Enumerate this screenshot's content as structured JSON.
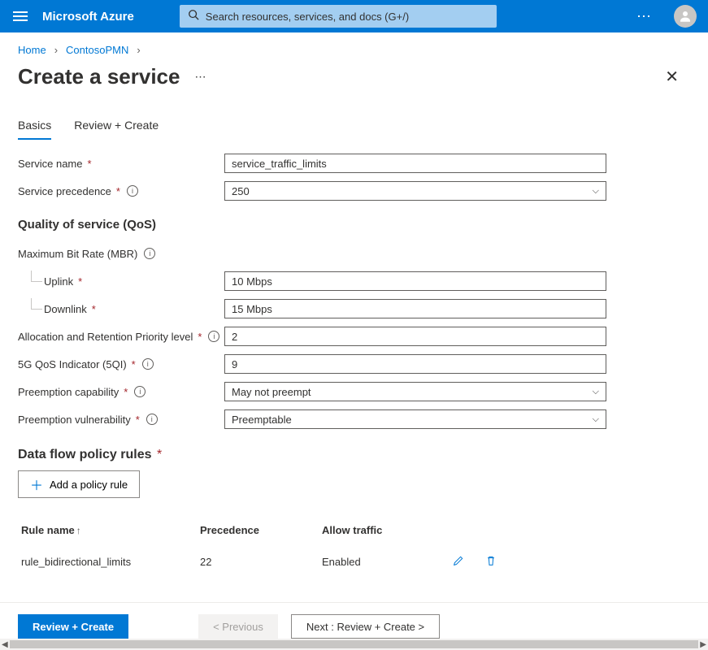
{
  "header": {
    "brand": "Microsoft Azure",
    "search_placeholder": "Search resources, services, and docs (G+/)"
  },
  "breadcrumb": {
    "items": [
      "Home",
      "ContosoPMN"
    ]
  },
  "page": {
    "title": "Create a service"
  },
  "tabs": [
    {
      "label": "Basics",
      "active": true
    },
    {
      "label": "Review + Create",
      "active": false
    }
  ],
  "fields": {
    "service_name": {
      "label": "Service name",
      "value": "service_traffic_limits"
    },
    "service_precedence": {
      "label": "Service precedence",
      "value": "250"
    }
  },
  "qos": {
    "heading": "Quality of service (QoS)",
    "mbr_label": "Maximum Bit Rate (MBR)",
    "uplink": {
      "label": "Uplink",
      "value": "10 Mbps"
    },
    "downlink": {
      "label": "Downlink",
      "value": "15 Mbps"
    },
    "arp": {
      "label": "Allocation and Retention Priority level",
      "value": "2"
    },
    "fiveqi": {
      "label": "5G QoS Indicator (5QI)",
      "value": "9"
    },
    "preempt_cap": {
      "label": "Preemption capability",
      "value": "May not preempt"
    },
    "preempt_vuln": {
      "label": "Preemption vulnerability",
      "value": "Preemptable"
    }
  },
  "rules": {
    "heading": "Data flow policy rules",
    "add_label": "Add a policy rule",
    "columns": {
      "name": "Rule name",
      "precedence": "Precedence",
      "allow": "Allow traffic"
    },
    "rows": [
      {
        "name": "rule_bidirectional_limits",
        "precedence": "22",
        "allow": "Enabled"
      }
    ]
  },
  "footer": {
    "review": "Review + Create",
    "previous": "< Previous",
    "next": "Next : Review + Create >"
  }
}
